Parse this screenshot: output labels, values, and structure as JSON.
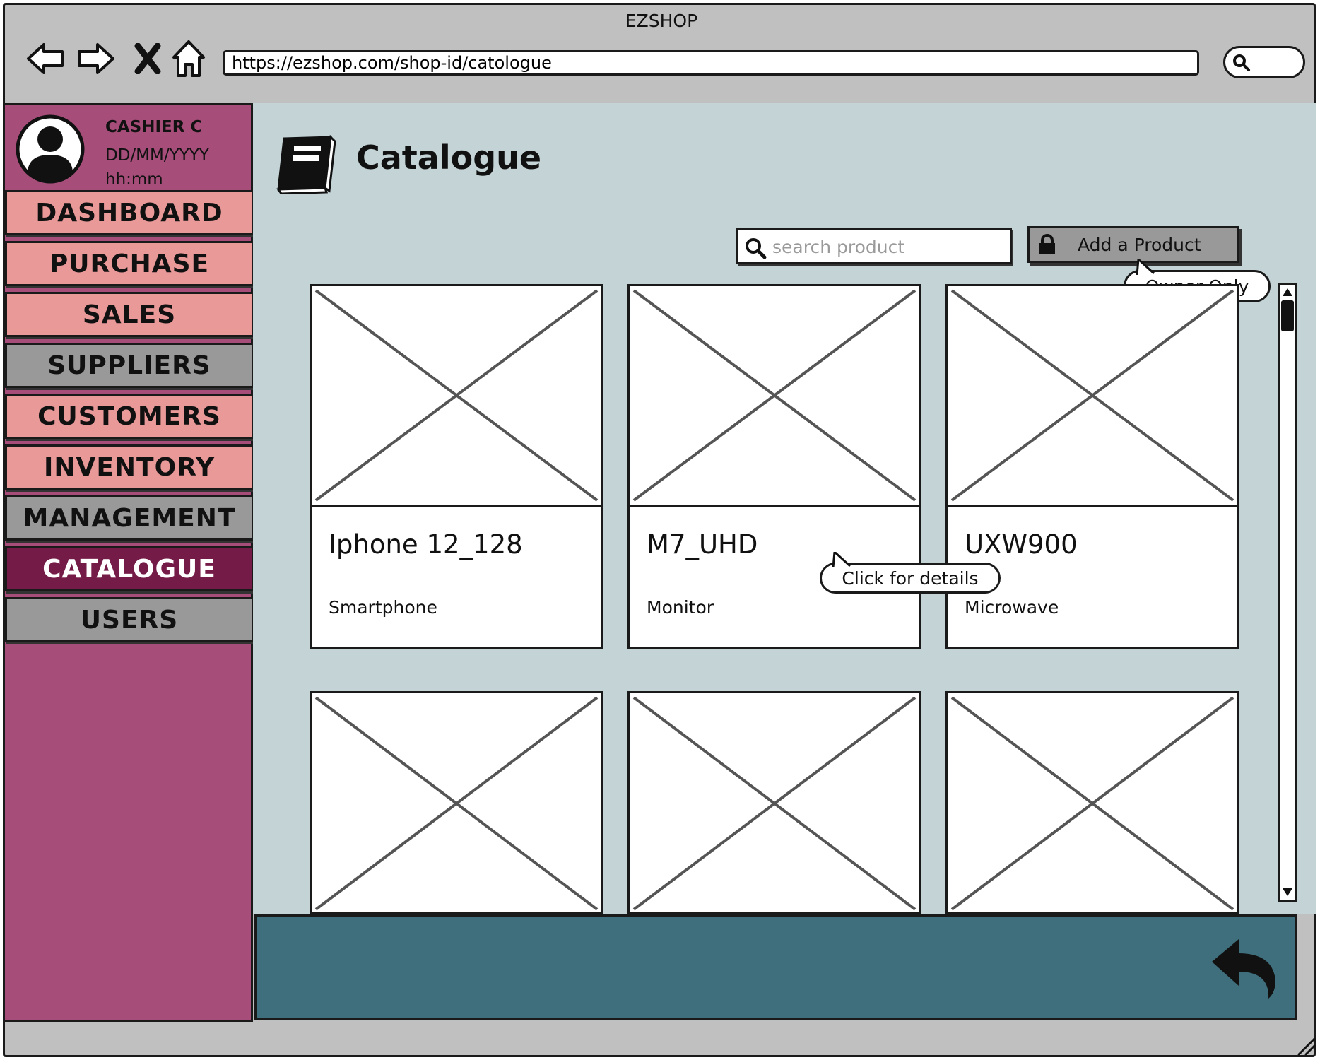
{
  "window": {
    "title": "EZSHOP"
  },
  "browser": {
    "url": "https://ezshop.com/shop-id/catologue",
    "nav_icons": [
      "back-arrow-icon",
      "forward-arrow-icon",
      "close-icon",
      "home-icon"
    ]
  },
  "user": {
    "name": "CASHIER C",
    "date": "DD/MM/YYYY",
    "time": "hh:mm"
  },
  "sidebar": {
    "items": [
      {
        "label": "DASHBOARD",
        "style": "pink"
      },
      {
        "label": "PURCHASE",
        "style": "pink"
      },
      {
        "label": "SALES",
        "style": "pink"
      },
      {
        "label": "SUPPLIERS",
        "style": "grey"
      },
      {
        "label": "CUSTOMERS",
        "style": "pink"
      },
      {
        "label": "INVENTORY",
        "style": "pink"
      },
      {
        "label": "MANAGEMENT",
        "style": "grey"
      },
      {
        "label": "CATALOGUE",
        "style": "active"
      },
      {
        "label": "USERS",
        "style": "grey"
      }
    ]
  },
  "page": {
    "title": "Catalogue",
    "icon": "book-icon"
  },
  "search": {
    "placeholder": "search product",
    "value": ""
  },
  "add_button": {
    "label": "Add a Product",
    "icon": "lock-icon"
  },
  "callouts": {
    "owner_only": "Owner Only",
    "click_details": "Click for details"
  },
  "products": [
    {
      "name": "Iphone 12_128",
      "category": "Smartphone"
    },
    {
      "name": "M7_UHD",
      "category": "Monitor"
    },
    {
      "name": "UXW900",
      "category": "Microwave"
    },
    {
      "name": "",
      "category": ""
    },
    {
      "name": "",
      "category": ""
    },
    {
      "name": "",
      "category": ""
    }
  ],
  "footer": {
    "back_icon": "undo-arrow-icon"
  },
  "colors": {
    "window_chrome": "#c0c0c0",
    "sidebar_bg": "#a64d79",
    "menu_pink": "#ea9999",
    "menu_grey": "#999999",
    "menu_active": "#741b47",
    "content_bg": "#c3d3d6",
    "footer_bg": "#3f6f7c"
  }
}
